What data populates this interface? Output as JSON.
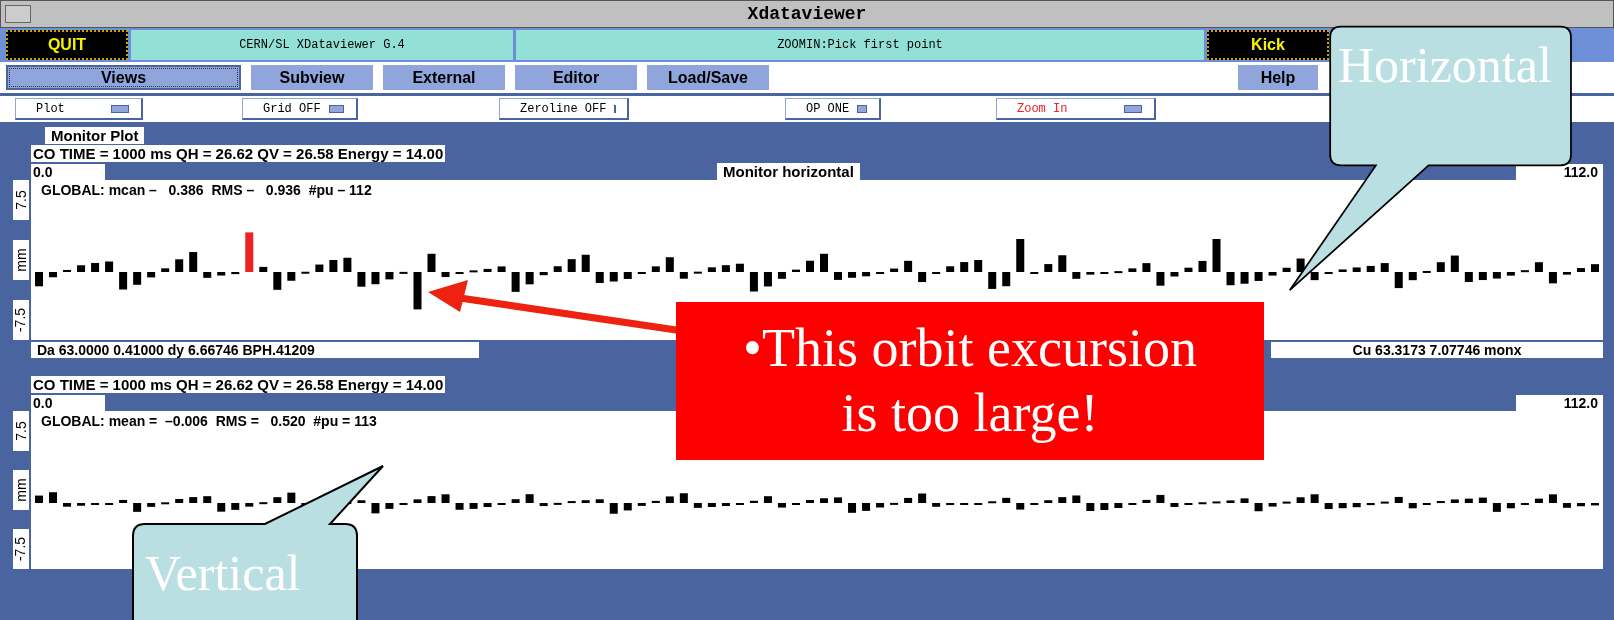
{
  "window": {
    "title": "Xdataviewer"
  },
  "top_bar": [
    {
      "kind": "action",
      "label": "QUIT"
    },
    {
      "kind": "info",
      "label": "CERN/SL XDataviewer G.4"
    },
    {
      "kind": "info",
      "label": "ZOOMIN:Pick first point"
    },
    {
      "kind": "action",
      "label": "Kick"
    }
  ],
  "tabs": [
    {
      "label": "Views",
      "selected": true
    },
    {
      "label": "Subview",
      "selected": false
    },
    {
      "label": "External",
      "selected": false
    },
    {
      "label": "Editor",
      "selected": false
    },
    {
      "label": "Load/Save",
      "selected": false
    },
    {
      "label": "Help",
      "selected": false
    }
  ],
  "options": [
    {
      "label": "Plot",
      "alert": false
    },
    {
      "label": "Grid OFF",
      "alert": false
    },
    {
      "label": "Zeroline OFF",
      "alert": false
    },
    {
      "label": "OP ONE",
      "alert": false
    },
    {
      "label": "Zoom In",
      "alert": true
    }
  ],
  "panel": {
    "title": "Monitor Plot"
  },
  "plots": [
    {
      "header": "CO TIME = 1000 ms QH = 26.62 QV = 26.58 Energy = 14.00",
      "start": "0.0",
      "title": "Monitor horizontal",
      "end": "112.0",
      "stats": "GLOBAL: mcan –   0.386  RMS –   0.936  #pu – 112",
      "y_labels": [
        "7.5",
        "mm",
        "-7.5"
      ],
      "footer_left": "Da 63.0000 0.41000 dy 6.66746  BPH.41209",
      "footer_right": "Cu 63.3173 7.07746 monx"
    },
    {
      "header": "CO TIME = 1000 ms QH = 26.62 QV = 26.58 Energy = 14.00",
      "start": "0.0",
      "end": "112.0",
      "stats": "GLOBAL: mean =  –0.006  RMS =   0.520  #pu = 113",
      "y_labels": [
        "7.5",
        "mm",
        "-7.5"
      ]
    }
  ],
  "annotations": [
    {
      "kind": "callout",
      "text": "Horizontal"
    },
    {
      "kind": "note",
      "text": "•This orbit excursion is too large!"
    },
    {
      "kind": "callout",
      "text": "Vertical"
    }
  ]
}
